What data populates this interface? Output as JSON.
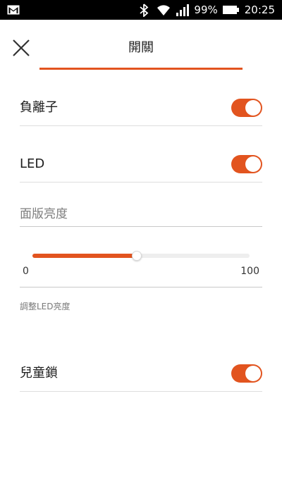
{
  "status_bar": {
    "battery_percent": "99%",
    "time": "20:25",
    "icons": [
      "gmail-icon",
      "bluetooth-icon",
      "wifi-icon",
      "signal-icon",
      "battery-icon"
    ]
  },
  "header": {
    "title": "開關",
    "close_icon": "close-icon"
  },
  "settings": {
    "negative_ion": {
      "label": "負離子",
      "enabled": true
    },
    "led": {
      "label": "LED",
      "enabled": true
    },
    "panel_brightness": {
      "placeholder": "面版亮度"
    },
    "brightness_slider": {
      "min_label": "0",
      "max_label": "100",
      "value_fraction": 0.48
    },
    "helper": "調整LED亮度",
    "child_lock": {
      "label": "兒童鎖",
      "enabled": true
    }
  },
  "colors": {
    "accent": "#e2541f",
    "divider": "#dedede"
  }
}
